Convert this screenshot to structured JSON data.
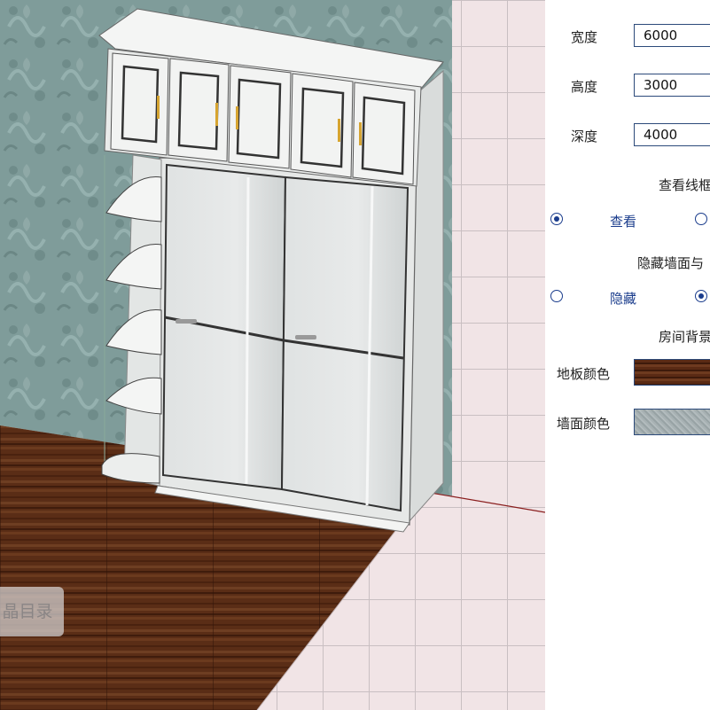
{
  "catalog_button": {
    "label": "晶目录"
  },
  "panel": {
    "width": {
      "label": "宽度",
      "value": "6000"
    },
    "height": {
      "label": "高度",
      "value": "3000"
    },
    "depth": {
      "label": "深度",
      "value": "4000"
    },
    "wireframe": {
      "title": "查看线框",
      "option_view": "查看",
      "selected": "view"
    },
    "hide_walls": {
      "title": "隐藏墙面与",
      "option_hide": "隐藏",
      "selected": "other"
    },
    "room_bg": {
      "title": "房间背景"
    },
    "floor_color": {
      "label": "地板颜色",
      "swatch": "#5a2a14"
    },
    "wall_color": {
      "label": "墙面颜色",
      "swatch": "#a7b1b3"
    }
  },
  "colors": {
    "wall": "#7f9c9a",
    "floor": "#5a2d16",
    "tile": "#f1e4e6",
    "cabinet": "#eef0ee",
    "accent": "#1a3c8c"
  }
}
